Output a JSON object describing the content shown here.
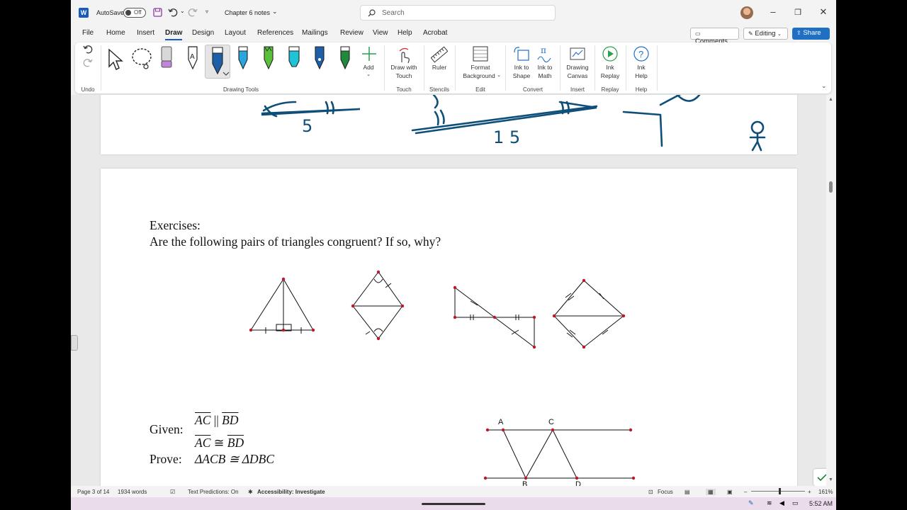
{
  "titlebar": {
    "autosave_label": "AutoSave",
    "autosave_state": "Off",
    "document_title": "Chapter 6 notes",
    "search_placeholder": "Search"
  },
  "menu": {
    "items": [
      "File",
      "Home",
      "Insert",
      "Draw",
      "Design",
      "Layout",
      "References",
      "Mailings",
      "Review",
      "View",
      "Help",
      "Acrobat"
    ],
    "active": "Draw",
    "comments_label": "Comments",
    "editing_label": "Editing",
    "share_label": "Share"
  },
  "ribbon": {
    "groups": {
      "undo": "Undo",
      "drawing_tools": "Drawing Tools",
      "touch": "Touch",
      "stencils": "Stencils",
      "edit": "Edit",
      "convert": "Convert",
      "insert": "Insert",
      "replay": "Replay",
      "help": "Help"
    },
    "buttons": {
      "add": "Add",
      "draw_with_touch_1": "Draw with",
      "draw_with_touch_2": "Touch",
      "ruler": "Ruler",
      "format_bg_1": "Format",
      "format_bg_2": "Background",
      "ink_shape_1": "Ink to",
      "ink_shape_2": "Shape",
      "ink_math_1": "Ink to",
      "ink_math_2": "Math",
      "canvas_1": "Drawing",
      "canvas_2": "Canvas",
      "ink_replay_1": "Ink",
      "ink_replay_2": "Replay",
      "ink_help_1": "Ink",
      "ink_help_2": "Help"
    },
    "pen_colors": [
      "#1f5fa8",
      "#2aa6de",
      "#5cc13a",
      "#20c4d8",
      "#1f5fa8",
      "#1e8a3a"
    ]
  },
  "document": {
    "handwritten": {
      "left": "5",
      "right": "1 5"
    },
    "exercises_title": "Exercises:",
    "question": "Are the following pairs of triangles congruent?  If so, why?",
    "given_label": "Given:",
    "given_line1_left": "AC",
    "given_line1_op": "||",
    "given_line1_right": "BD",
    "given_line2_left": "AC",
    "given_line2_op": "≅",
    "given_line2_right": "BD",
    "prove_label": "Prove:",
    "prove_statement": "ΔACB ≅ ΔDBC",
    "figure_labels": {
      "a": "A",
      "c": "C",
      "b": "B",
      "d": "D"
    }
  },
  "status": {
    "page": "Page 3 of 14",
    "words": "1934 words",
    "text_predictions": "Text Predictions: On",
    "accessibility": "Accessibility: Investigate",
    "focus": "Focus",
    "zoom": "161%"
  },
  "taskbar": {
    "time": "5:52 AM"
  }
}
